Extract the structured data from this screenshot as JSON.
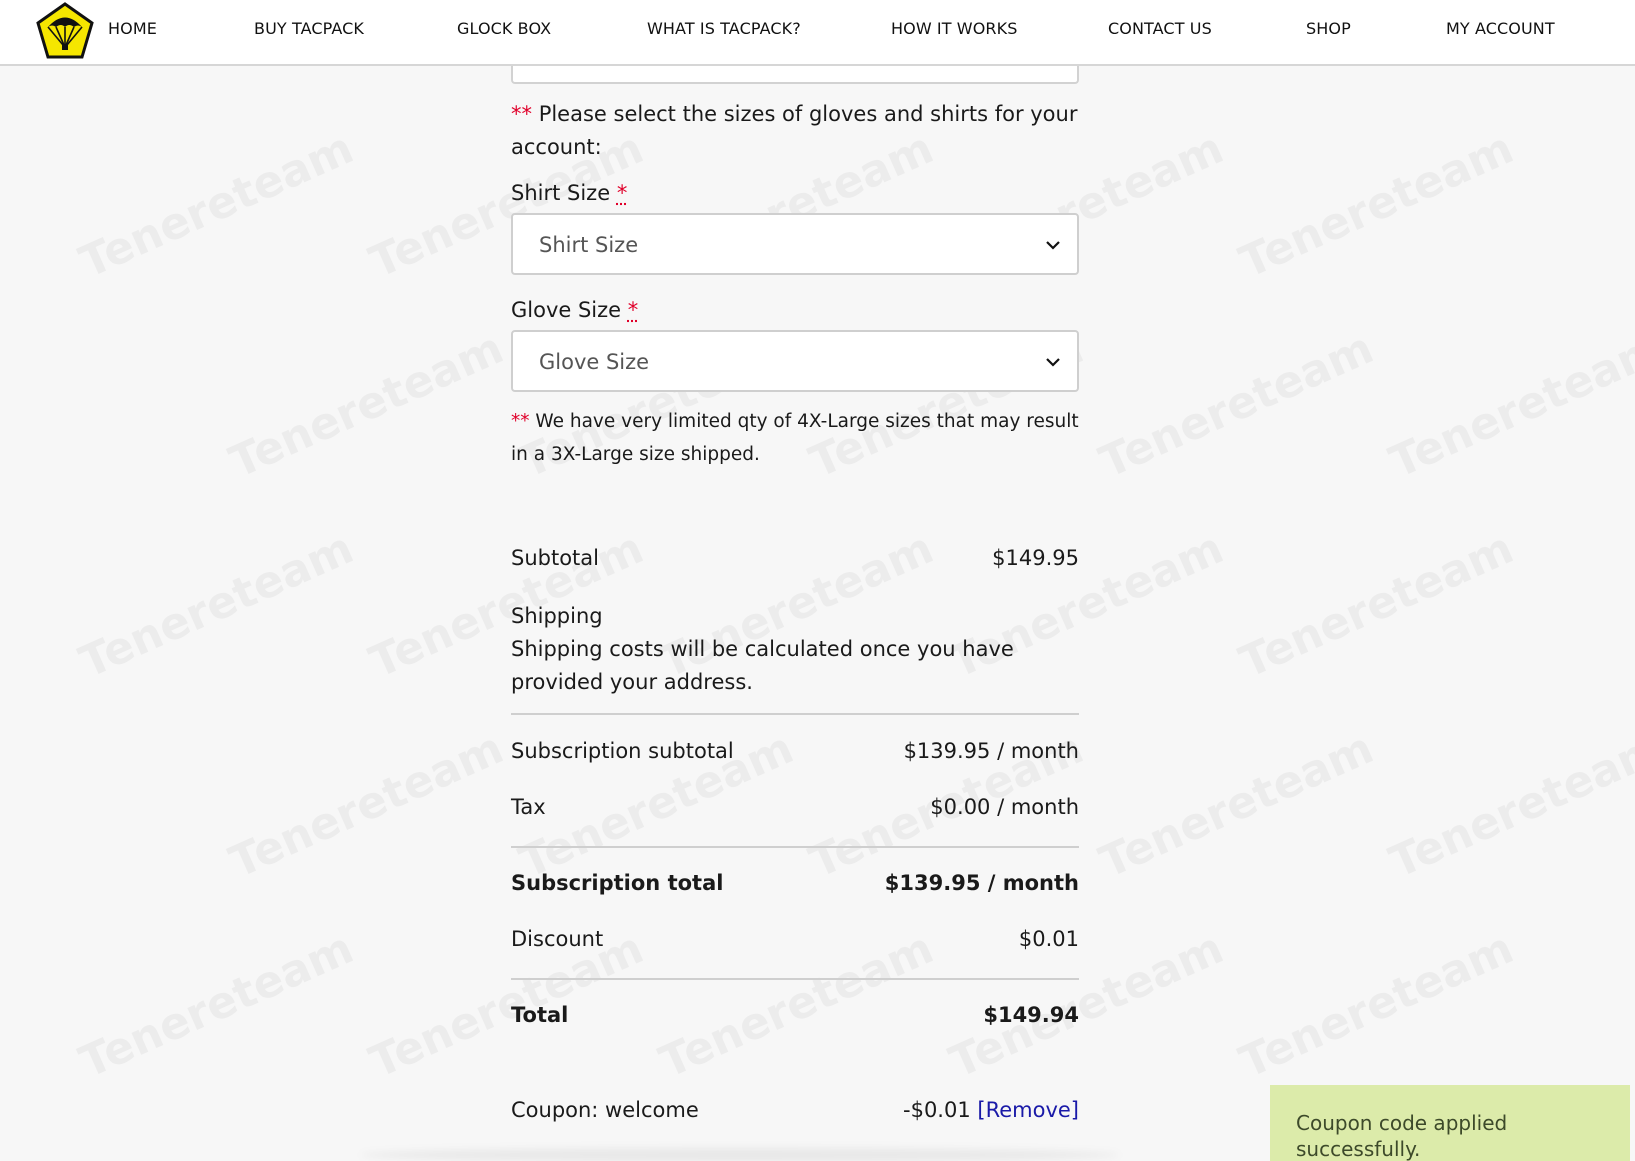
{
  "nav": {
    "items": [
      "HOME",
      "BUY TACPACK",
      "GLOCK BOX",
      "WHAT IS TACPACK?",
      "HOW IT WORKS",
      "CONTACT US",
      "SHOP",
      "MY ACCOUNT"
    ]
  },
  "form": {
    "required_mark": "**",
    "intro_note": "Please select the sizes of gloves and shirts for your account:",
    "field_required_mark": "*",
    "shirt_label": "Shirt Size",
    "shirt_placeholder": "Shirt Size",
    "glove_label": "Glove Size",
    "glove_placeholder": "Glove Size",
    "limited_note": "We have very limited qty of 4X-Large sizes that may result in a 3X-Large size shipped."
  },
  "summary": {
    "subtotal_label": "Subtotal",
    "subtotal_value": "$149.95",
    "shipping_label": "Shipping",
    "shipping_note": "Shipping costs will be calculated once you have provided your address.",
    "subscription_subtotal_label": "Subscription subtotal",
    "subscription_subtotal_value": "$139.95 / month",
    "tax_label": "Tax",
    "tax_value": "$0.00 / month",
    "subscription_total_label": "Subscription total",
    "subscription_total_value": "$139.95 / month",
    "discount_label": "Discount",
    "discount_value": "$0.01",
    "total_label": "Total",
    "total_value": "$149.94",
    "coupon_label": "Coupon: welcome",
    "coupon_value": "-$0.01",
    "coupon_remove": "[Remove]"
  },
  "toast": {
    "message": "Coupon code applied successfully."
  },
  "watermark": "Tenereteam",
  "colors": {
    "logo_fill": "#f5e600",
    "required": "#e0002a",
    "link": "#1a1aa8",
    "toast_bg": "#dcebaa"
  }
}
